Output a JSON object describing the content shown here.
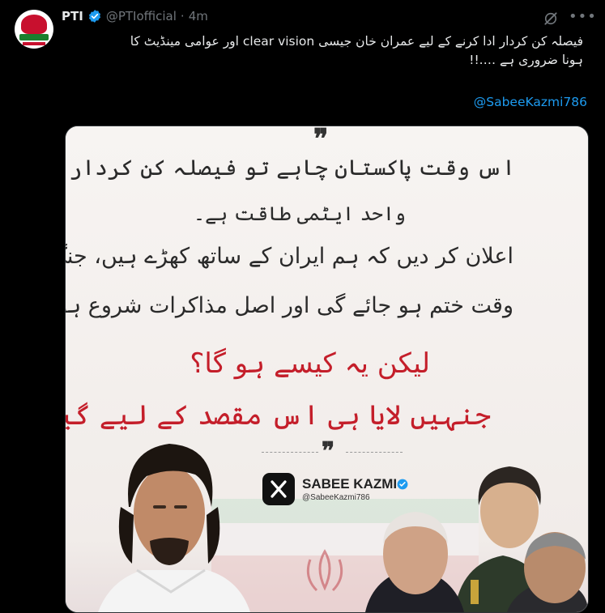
{
  "author": {
    "name": "PTI",
    "handle": "@PTIofficial",
    "separator": "·",
    "time": "4m"
  },
  "icons": {
    "avatar": "pti-logo-avatar",
    "verified": "verified-badge-icon",
    "grok": "grok-icon",
    "more": "more-options-icon"
  },
  "tweet": {
    "line1": "فیصلہ کن کردار ادا کرنے کے لیے عمران خان جیسی clear vision اور عوامی مینڈیٹ کا",
    "line2": "ہونا ضروری ہے ….!!",
    "mention": "@SabeeKazmi786"
  },
  "image": {
    "line1": "اس وقت پاکستان چاہے تو فیصلہ کن کردار ادا کر سکتا ہے۔",
    "line2": "واحد ایٹمی طاقت ہے۔",
    "line3": "اعلان کر دیں کہ ہم ایران کے ساتھ کھڑے ہیں، جنگ اسی",
    "line4": "وقت ختم ہو جائے گی اور اصل مذاکرات شروع ہوں گے۔",
    "red_line1": "لیکن یہ کیسے ہو گا؟",
    "red_line2": "جنہیں لایا ہی اس مقصد کے لیے گیا ہے۔",
    "quote_mark": "❞",
    "watermark_name": "SABEE KAZMI",
    "watermark_handle": "@SabeeKazmi786"
  },
  "colors": {
    "link": "#1d9bf0",
    "verified": "#1d9bf0",
    "urdu_dark": "#2a2a2a",
    "urdu_red": "#c41e2a"
  }
}
